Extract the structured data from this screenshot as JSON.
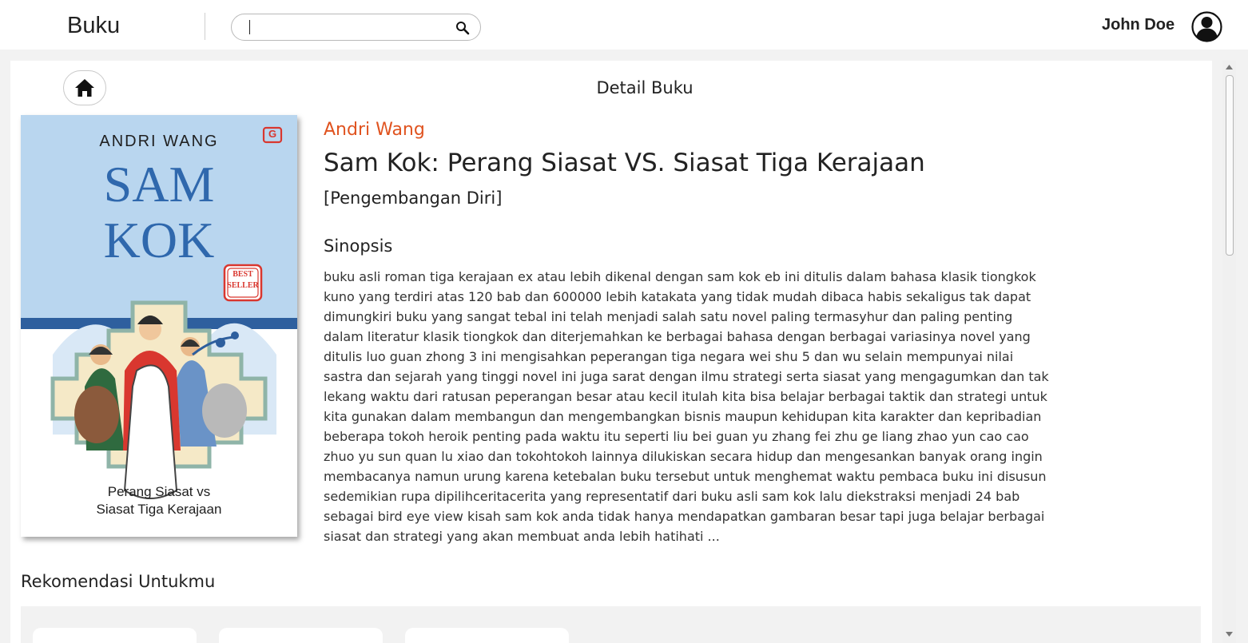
{
  "header": {
    "brand": "Buku",
    "search": {
      "value": "",
      "placeholder": ""
    },
    "user_name": "John Doe"
  },
  "page": {
    "title": "Detail Buku"
  },
  "book": {
    "author": "Andri Wang",
    "title": "Sam Kok: Perang Siasat VS. Siasat Tiga Kerajaan",
    "category": "[Pengembangan Diri]",
    "synopsis_heading": "Sinopsis",
    "synopsis": "buku asli roman tiga kerajaan ex atau lebih dikenal dengan sam kok eb ini ditulis dalam bahasa klasik tiongkok kuno yang terdiri atas 120 bab dan 600000 lebih katakata yang tidak mudah dibaca habis sekaligus tak dapat dimungkiri buku yang sangat tebal ini telah menjadi salah satu novel paling termasyhur dan paling penting dalam literatur klasik tiongkok dan diterjemahkan ke berbagai bahasa dengan berbagai variasinya novel yang ditulis luo guan zhong 3 ini mengisahkan peperangan tiga negara wei  shu 5 dan wu  selain mempunyai nilai sastra dan sejarah yang tinggi novel ini juga sarat dengan ilmu strategi serta siasat yang mengagumkan dan tak lekang waktu dari ratusan peperangan besar atau kecil itulah kita bisa belajar berbagai taktik dan strategi untuk kita gunakan dalam membangun dan mengembangkan bisnis maupun kehidupan kita karakter dan kepribadian beberapa tokoh heroik penting pada waktu itu seperti liu bei guan yu zhang fei zhu ge liang zhao yun cao cao zhuo yu sun quan lu xiao dan tokohtokoh lainnya dilukiskan secara hidup dan mengesankan banyak orang ingin membacanya namun urung karena ketebalan buku tersebut untuk menghemat waktu pembaca buku ini disusun sedemikian rupa dipilihceritacerita yang representatif dari buku asli sam kok lalu diekstraksi menjadi 24 bab sebagai bird eye view kisah sam kok anda tidak hanya mendapatkan gambaran besar tapi juga belajar berbagai siasat dan strategi yang akan membuat anda lebih hatihati ...",
    "cover": {
      "author": "ANDRI WANG",
      "title_line1": "SAM",
      "title_line2": "KOK",
      "badge_line1": "BEST",
      "badge_line2": "SELLER",
      "publisher_mark": "G",
      "subtitle_line1": "Perang Siasat vs",
      "subtitle_line2": "Siasat Tiga Kerajaan"
    }
  },
  "recommendations": {
    "heading": "Rekomendasi Untukmu"
  },
  "icons": {
    "search": "search-icon",
    "avatar": "user-icon",
    "home": "home-icon"
  },
  "colors": {
    "accent": "#e0531f",
    "cover_sky": "#b9d6ef",
    "cover_title": "#2f68ad",
    "cover_red": "#d9372f"
  }
}
